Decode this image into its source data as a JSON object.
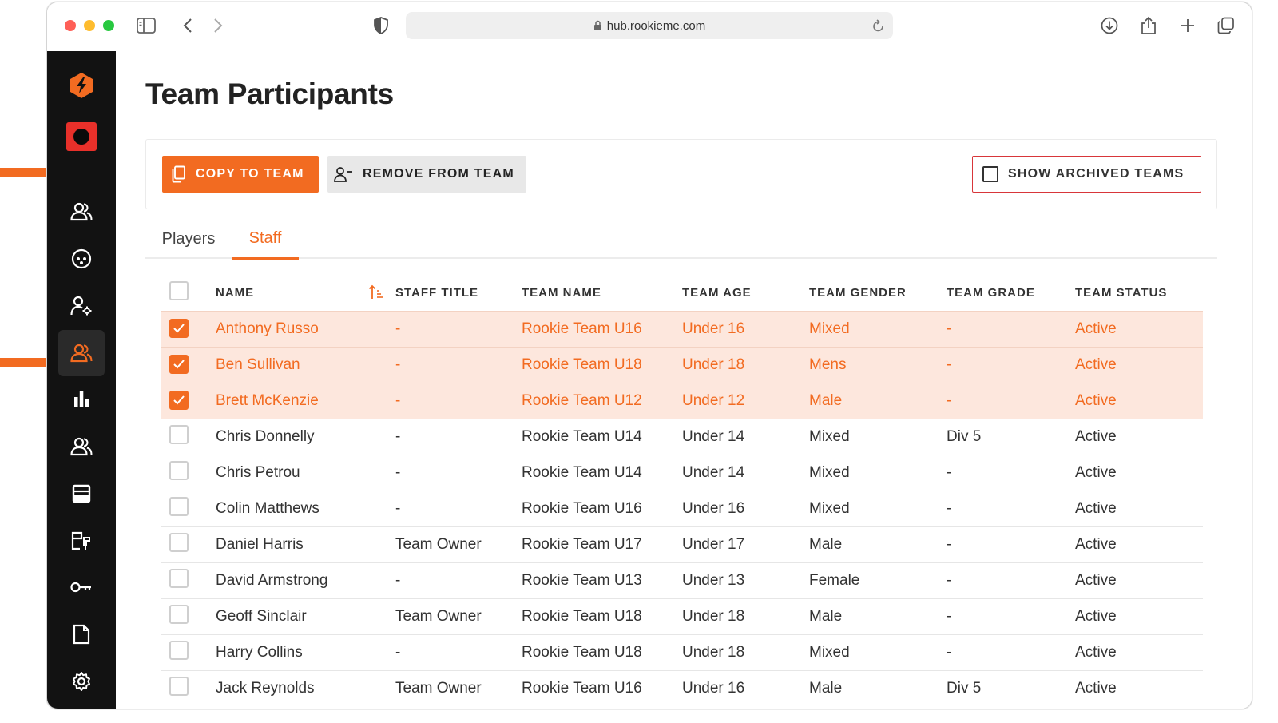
{
  "browser": {
    "url": "hub.rookieme.com"
  },
  "page": {
    "title": "Team Participants"
  },
  "toolbar": {
    "copy_label": "COPY TO TEAM",
    "remove_label": "REMOVE FROM TEAM",
    "archived_label": "SHOW ARCHIVED TEAMS"
  },
  "tabs": [
    {
      "label": "Players",
      "active": false
    },
    {
      "label": "Staff",
      "active": true
    }
  ],
  "table": {
    "columns": [
      "NAME",
      "STAFF TITLE",
      "TEAM NAME",
      "TEAM AGE",
      "TEAM GENDER",
      "TEAM GRADE",
      "TEAM STATUS"
    ],
    "rows": [
      {
        "selected": true,
        "cells": [
          "Anthony Russo",
          "-",
          "Rookie Team U16",
          "Under 16",
          "Mixed",
          "-",
          "Active"
        ]
      },
      {
        "selected": true,
        "cells": [
          "Ben Sullivan",
          "-",
          "Rookie Team U18",
          "Under 18",
          "Mens",
          "-",
          "Active"
        ]
      },
      {
        "selected": true,
        "cells": [
          "Brett McKenzie",
          "-",
          "Rookie Team U12",
          "Under 12",
          "Male",
          "-",
          "Active"
        ]
      },
      {
        "selected": false,
        "cells": [
          "Chris Donnelly",
          "-",
          "Rookie Team U14",
          "Under 14",
          "Mixed",
          "Div 5",
          "Active"
        ]
      },
      {
        "selected": false,
        "cells": [
          "Chris Petrou",
          "-",
          "Rookie Team U14",
          "Under 14",
          "Mixed",
          "-",
          "Active"
        ]
      },
      {
        "selected": false,
        "cells": [
          "Colin Matthews",
          "-",
          "Rookie Team U16",
          "Under 16",
          "Mixed",
          "-",
          "Active"
        ]
      },
      {
        "selected": false,
        "cells": [
          "Daniel Harris",
          "Team Owner",
          "Rookie Team U17",
          "Under 17",
          "Male",
          "-",
          "Active"
        ]
      },
      {
        "selected": false,
        "cells": [
          "David Armstrong",
          "-",
          "Rookie Team U13",
          "Under 13",
          "Female",
          "-",
          "Active"
        ]
      },
      {
        "selected": false,
        "cells": [
          "Geoff Sinclair",
          "Team Owner",
          "Rookie Team U18",
          "Under 18",
          "Male",
          "-",
          "Active"
        ]
      },
      {
        "selected": false,
        "cells": [
          "Harry Collins",
          "-",
          "Rookie Team U18",
          "Under 18",
          "Mixed",
          "-",
          "Active"
        ]
      },
      {
        "selected": false,
        "cells": [
          "Jack Reynolds",
          "Team Owner",
          "Rookie Team U16",
          "Under 16",
          "Male",
          "Div 5",
          "Active"
        ]
      }
    ]
  },
  "sidebar": {
    "icons": [
      "logo-icon",
      "record-icon",
      "users-icon",
      "clubs-icon",
      "user-settings-icon",
      "team-participants-icon",
      "reports-icon",
      "members-icon",
      "list-icon",
      "forms-icon",
      "key-icon",
      "document-icon",
      "gear-icon"
    ],
    "active_icon": "team-participants-icon"
  },
  "colors": {
    "accent": "#f26b21",
    "selected_row_bg": "#fde7dd",
    "sidebar_bg": "#121212",
    "archived_border": "#d8363a"
  }
}
